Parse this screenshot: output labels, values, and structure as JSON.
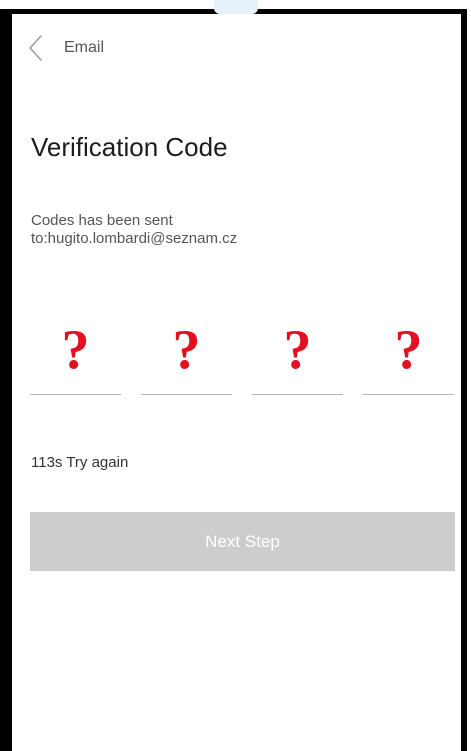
{
  "header": {
    "back_icon": "chevron-left-icon",
    "title": "Email"
  },
  "page": {
    "title": "Verification Code",
    "sent_line_1": "Codes has been sent",
    "sent_line_2": "to:hugito.lombardi@seznam.cz"
  },
  "code_inputs": [
    {
      "value": "?"
    },
    {
      "value": "?"
    },
    {
      "value": "?"
    },
    {
      "value": "?"
    }
  ],
  "resend": {
    "text": "113s Try again"
  },
  "next_button": {
    "label": "Next Step",
    "state": "disabled",
    "background": "#cdcdcd"
  },
  "colors": {
    "code_placeholder": "#e3101f",
    "frame": "#000000"
  }
}
